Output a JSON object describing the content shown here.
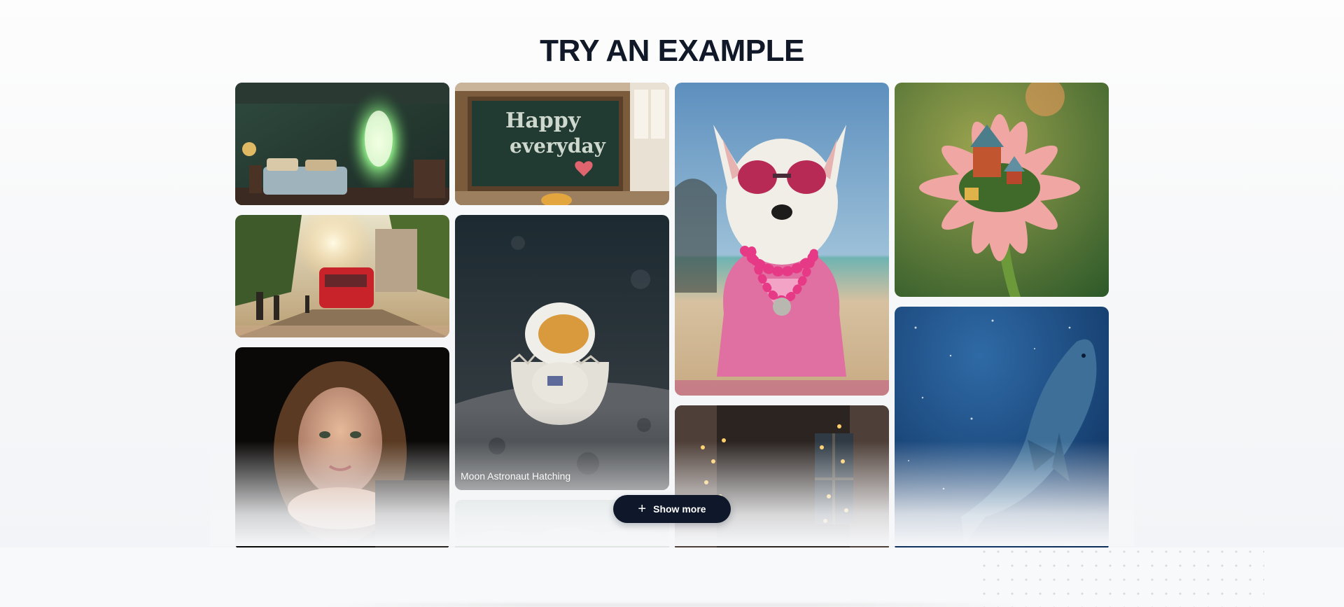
{
  "section": {
    "title": "TRY AN EXAMPLE"
  },
  "gallery": {
    "items": [
      {
        "subject": "bedroom with glowing forest portal",
        "caption": ""
      },
      {
        "subject": "chalkboard Happy everyday",
        "caption": ""
      },
      {
        "subject": "westie dog with pink sunglasses",
        "caption": ""
      },
      {
        "subject": "tiny houses on pink flower",
        "caption": ""
      },
      {
        "subject": "street with red tram at sunset",
        "caption": ""
      },
      {
        "subject": "astronaut hatching from egg",
        "caption": "Moon Astronaut Hatching"
      },
      {
        "subject": "portrait of woman",
        "caption": ""
      },
      {
        "subject": "window with fairy lights",
        "caption": ""
      },
      {
        "subject": "whale in starry sky",
        "caption": ""
      },
      {
        "subject": "misty landscape",
        "caption": ""
      }
    ]
  },
  "actions": {
    "show_more_label": "Show more",
    "show_more_icon": "plus-icon"
  }
}
